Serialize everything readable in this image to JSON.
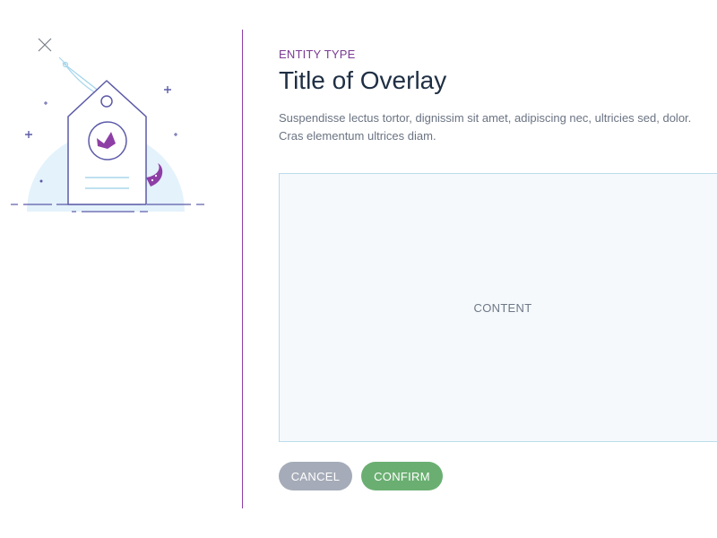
{
  "overlay": {
    "close_icon": "close-icon",
    "entity_type": "ENTITY TYPE",
    "title": "Title of Overlay",
    "description": "Suspendisse lectus tortor, dignissim sit amet, adipiscing nec, ultricies sed, dolor. Cras elementum ultrices diam.",
    "content_label": "CONTENT",
    "cancel_label": "CANCEL",
    "confirm_label": "CONFIRM"
  },
  "illustration": {
    "icon": "price-tag-illustration",
    "colors": {
      "outline": "#5c5aa8",
      "accent": "#8e3fa6",
      "bubble": "#e3f2fb",
      "string": "#a8d7ec"
    }
  },
  "colors": {
    "divider": "#8e3fa6",
    "entity_type": "#7b3a93",
    "title": "#1f2f44",
    "content_bg": "#f5f9fc",
    "content_border": "#bcdceb",
    "cancel_bg": "#a5abb8",
    "confirm_bg": "#6aaf71"
  }
}
